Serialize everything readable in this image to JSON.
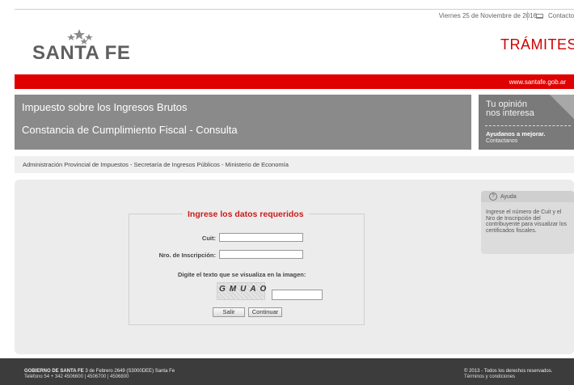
{
  "header": {
    "date": "Viernes 25 de Noviembre de 2016",
    "contact_label": "Contacto",
    "logo_text": "SANTA FE",
    "section_title": "TRÁMITES",
    "site_url": "www.santafe.gob.ar"
  },
  "banner": {
    "title": "Impuesto sobre los Ingresos Brutos",
    "subtitle": "Constancia de Cumplimiento Fiscal - Consulta"
  },
  "opinion": {
    "line1": "Tu opinión",
    "line2": "nos interesa",
    "cta": "Ayudanos a mejorar.",
    "contact": "Contactanos"
  },
  "breadcrumb": "Administración Provincial de Impuestos - Secretaría de Ingresos Públicos - Ministerio de Economía",
  "form": {
    "legend": "Ingrese los datos requeridos",
    "cuit_label": "Cuit:",
    "cuit_value": "",
    "inscripcion_label": "Nro. de Inscripción:",
    "inscripcion_value": "",
    "captcha_prompt": "Digite el texto que se visualiza en la imagen:",
    "captcha_text": "GMUAO",
    "captcha_value": "",
    "salir_label": "Salir",
    "continuar_label": "Continuar"
  },
  "help": {
    "title": "Ayuda",
    "body": "Ingrese el número de Cuit y el Nro de Inscripción del contribuyente para visualizar los certificados fiscales."
  },
  "footer": {
    "org": "GOBIERNO DE SANTA FE",
    "address": "3 de Febrero 2649 (S3000DEE) Santa Fe",
    "phone": "Teléfono 54 + 342 4506600 | 4506700 | 4506800",
    "copyright": "© 2013 - Todos los derechos reservados.",
    "terms": "Términos y condiciones"
  },
  "colors": {
    "brand_red": "#df0000",
    "banner_gray": "#8a8a8a",
    "footer_dark": "#3c3c3c"
  }
}
